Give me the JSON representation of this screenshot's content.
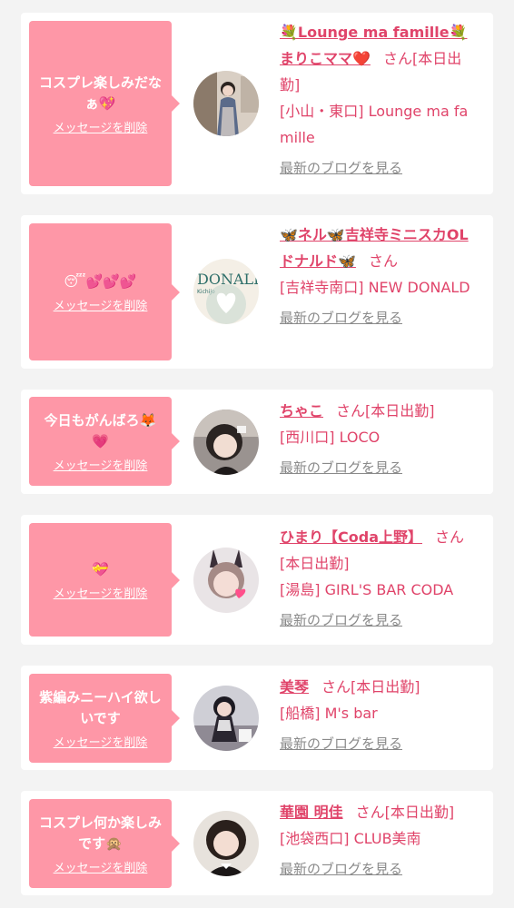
{
  "items": [
    {
      "message": "コスプレ楽しみだなぁ💖",
      "delete_label": "メッセージを削除",
      "name": "💐Lounge ma famille💐まりこママ❤️",
      "san": "さん",
      "status": "[本日出勤]",
      "location": "[小山・東口] Lounge ma famille",
      "blog_label": "最新のブログを見る",
      "avatar_icon": "cast-photo"
    },
    {
      "message": "😴💕💕💕",
      "delete_label": "メッセージを削除",
      "name": "🦋ネル🦋吉祥寺ミニスカOLドナルド🦋",
      "san": "さん",
      "status": "",
      "location": "[吉祥寺南口] NEW DONALD",
      "blog_label": "最新のブログを見る",
      "avatar_icon": "cast-photo"
    },
    {
      "message": "今日もがんばろ🦊💗",
      "delete_label": "メッセージを削除",
      "name": "ちゃこ",
      "san": "さん",
      "status": "[本日出勤]",
      "location": "[西川口] LOCO",
      "blog_label": "最新のブログを見る",
      "avatar_icon": "cast-photo"
    },
    {
      "message": "💝",
      "delete_label": "メッセージを削除",
      "name": "ひまり【Coda上野】",
      "san": "さん",
      "status": "[本日出勤]",
      "location": "[湯島] GIRL'S BAR CODA",
      "blog_label": "最新のブログを見る",
      "avatar_icon": "cast-photo"
    },
    {
      "message": "紫編みニーハイ欲しいです",
      "delete_label": "メッセージを削除",
      "name": "美琴",
      "san": "さん",
      "status": "[本日出勤]",
      "location": "[船橋] M's bar",
      "blog_label": "最新のブログを見る",
      "avatar_icon": "cast-photo"
    },
    {
      "message": "コスプレ何か楽しみです🙊",
      "delete_label": "メッセージを削除",
      "name": "華園 明佳",
      "san": "さん",
      "status": "[本日出勤]",
      "location": "[池袋西口] CLUB美南",
      "blog_label": "最新のブログを見る",
      "avatar_icon": "cast-photo"
    }
  ],
  "colors": {
    "bubble": "#fe97a7",
    "name": "#e0446a",
    "blog_link": "#8a8a8a",
    "background": "#f3f3f3"
  }
}
